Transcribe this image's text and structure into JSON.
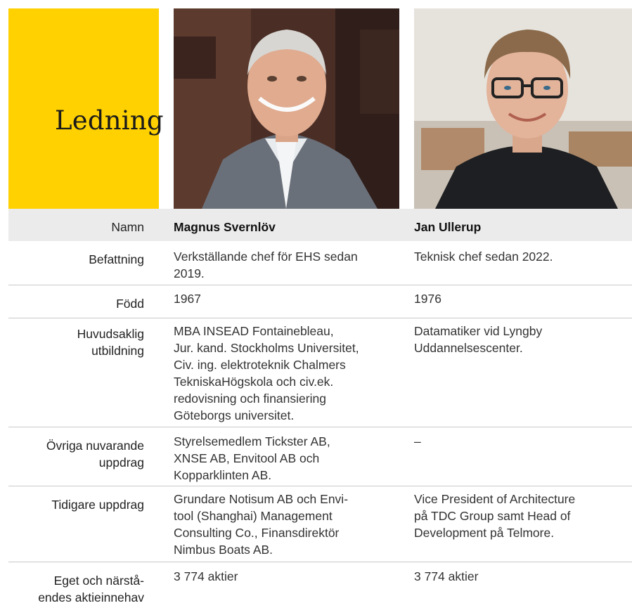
{
  "heading": "Ledning",
  "photos": {
    "person1": "photo-magnus-svernlov",
    "person2": "photo-jan-ullerup"
  },
  "rows": {
    "name": {
      "label": "Namn",
      "p1": "Magnus Svernlöv",
      "p2": "Jan Ullerup"
    },
    "position": {
      "label": "Befattning",
      "p1": "Verkställande chef för EHS sedan\n2019.",
      "p2": "Teknisk chef sedan 2022."
    },
    "born": {
      "label": "Född",
      "p1": "1967",
      "p2": "1976"
    },
    "education": {
      "label": "Huvudsaklig\nutbildning",
      "p1": "MBA INSEAD Fontainebleau,\nJur. kand. Stockholms Universitet,\nCiv. ing. elektroteknik Chalmers\nTekniskaHögskola och civ.ek.\nredovisning och finansiering\nGöteborgs universitet.",
      "p2": "Datamatiker vid Lyngby\nUddannelsescenter."
    },
    "current": {
      "label": "Övriga nuvarande\nuppdrag",
      "p1": "Styrelsemedlem Tickster AB,\nXNSE AB, Envitool AB och\nKopparklinten AB.",
      "p2": "–"
    },
    "previous": {
      "label": "Tidigare uppdrag",
      "p1": "Grundare Notisum AB och Envi-\ntool (Shanghai) Management\nConsulting Co., Finansdirektör\nNimbus Boats AB.",
      "p2": "Vice President of Architecture\npå TDC Group samt Head of\nDevelopment på Telmore."
    },
    "shares": {
      "label": "Eget och närstå-\nendes aktieinnehav",
      "p1": "3 774 aktier",
      "p2": "3 774 aktier"
    }
  },
  "colors": {
    "accent": "#ffd100",
    "header_row": "#ebebeb",
    "divider": "#c8c8c8"
  }
}
